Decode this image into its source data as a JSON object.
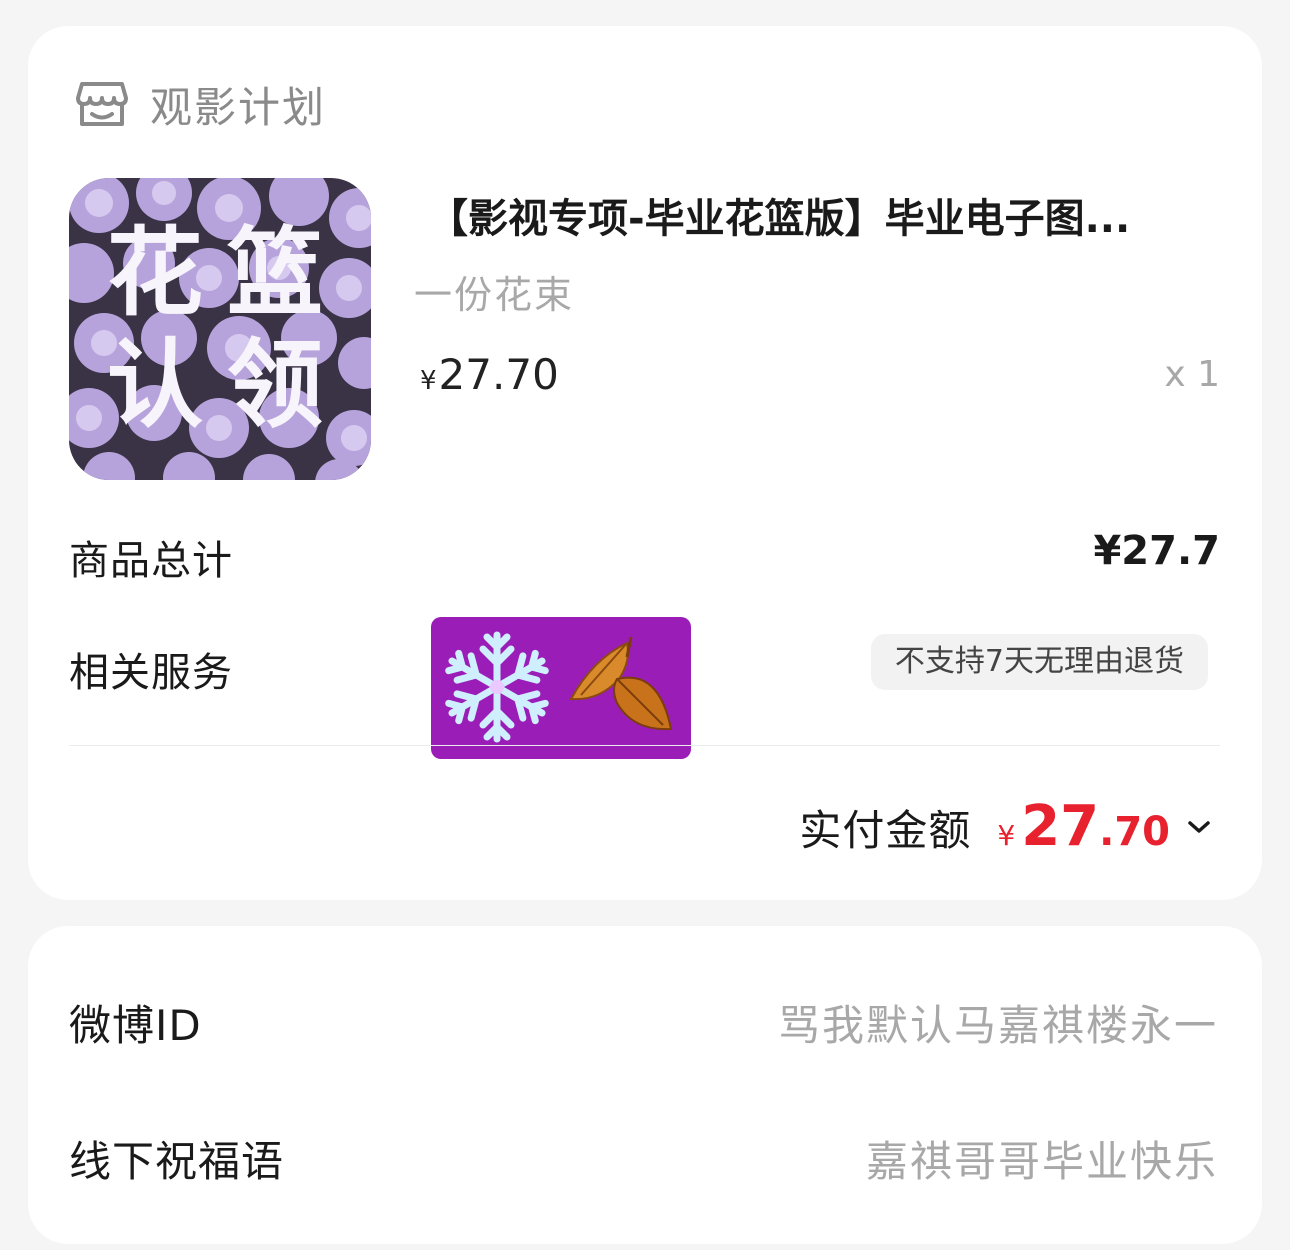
{
  "shop": {
    "name": "观影计划",
    "icon": "store-icon"
  },
  "product": {
    "thumbnail_text": [
      "花",
      "篮",
      "认",
      "领"
    ],
    "title": "【影视专项-毕业花篮版】毕业电子图...",
    "spec": "一份花束",
    "price_currency": "¥",
    "price": "27.70",
    "quantity": "x 1"
  },
  "summary": {
    "total_label": "商品总计",
    "total_value": "¥27.7",
    "service_label": "相关服务",
    "service_badge": "不支持7天无理由退货",
    "sticker_icons": [
      "snowflake-icon",
      "fallen-leaf-icon"
    ]
  },
  "payment": {
    "label": "实付金额",
    "currency": "¥",
    "integer": "27",
    "decimal": ".70",
    "expand_icon": "chevron-down-icon"
  },
  "info": {
    "weibo_label": "微博ID",
    "weibo_value": "骂我默认马嘉祺楼永一",
    "blessing_label": "线下祝福语",
    "blessing_value": "嘉祺哥哥毕业快乐"
  },
  "colors": {
    "accent_price": "#e8212f",
    "sticker_bg": "#9b1db8",
    "muted_text": "#a8a8a8"
  }
}
